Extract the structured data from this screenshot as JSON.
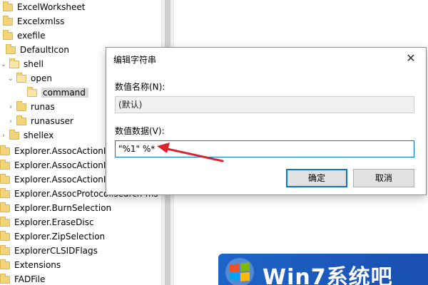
{
  "tree": {
    "items": [
      {
        "label": "ExcelWorksheet"
      },
      {
        "label": "Excelxmlss"
      },
      {
        "label": "exefile"
      },
      {
        "label": "DefaultIcon"
      },
      {
        "label": "shell"
      },
      {
        "label": "open"
      },
      {
        "label": "command"
      },
      {
        "label": "runas"
      },
      {
        "label": "runasuser"
      },
      {
        "label": "shellex"
      },
      {
        "label": "Explorer.AssocActionId.BurnSelection"
      },
      {
        "label": "Explorer.AssocActionId.CloseSession"
      },
      {
        "label": "Explorer.AssocActionId.EraseDisc"
      },
      {
        "label": "Explorer.AssocProtocol.search-ms"
      },
      {
        "label": "Explorer.BurnSelection"
      },
      {
        "label": "Explorer.EraseDisc"
      },
      {
        "label": "Explorer.ZipSelection"
      },
      {
        "label": "ExplorerCLSIDFlags"
      },
      {
        "label": "Extensions"
      },
      {
        "label": "FADFile"
      }
    ]
  },
  "dialog": {
    "title": "编辑字符串",
    "name_label": "数值名称(N):",
    "name_value": "(默认)",
    "data_label": "数值数据(V):",
    "data_value": "\"%1\" %*",
    "ok_label": "确定",
    "cancel_label": "取消"
  },
  "watermark": {
    "text": "Win7系统吧"
  },
  "colors": {
    "accent": "#0078d7",
    "arrow": "#d9232e",
    "folder": "#f4d47a"
  }
}
